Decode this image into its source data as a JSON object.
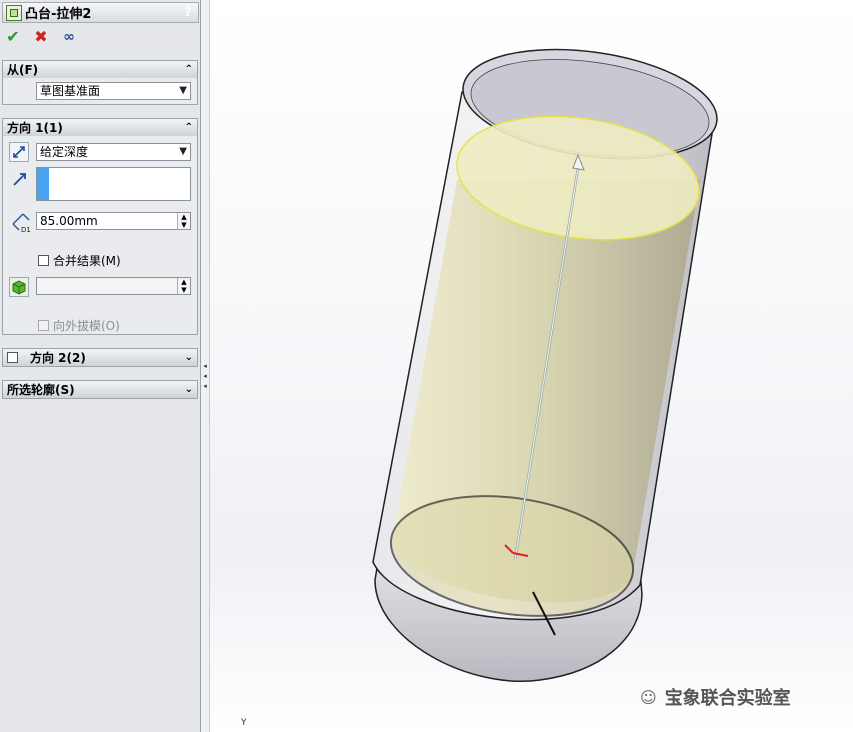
{
  "feature": {
    "title": "凸台-拉伸2",
    "help": "?"
  },
  "actions": {
    "ok_icon": "checkmark-icon",
    "cancel_icon": "x-icon",
    "preview_icon": "glasses-icon"
  },
  "from_group": {
    "header": "从(F)",
    "start_condition": "草图基准面"
  },
  "direction1": {
    "header": "方向 1(1)",
    "end_condition": "给定深度",
    "depth": "85.00mm",
    "merge_label": "合并结果(M)",
    "merge_checked": false,
    "draft_label": "向外拔模(O)",
    "draft_checked": false,
    "draft_value": ""
  },
  "direction2": {
    "header": "方向 2(2)",
    "checked": false
  },
  "contours": {
    "header": "所选轮廓(S)"
  },
  "viewport": {
    "triad_label": "Y"
  },
  "watermark": {
    "text": "宝象联合实验室"
  }
}
